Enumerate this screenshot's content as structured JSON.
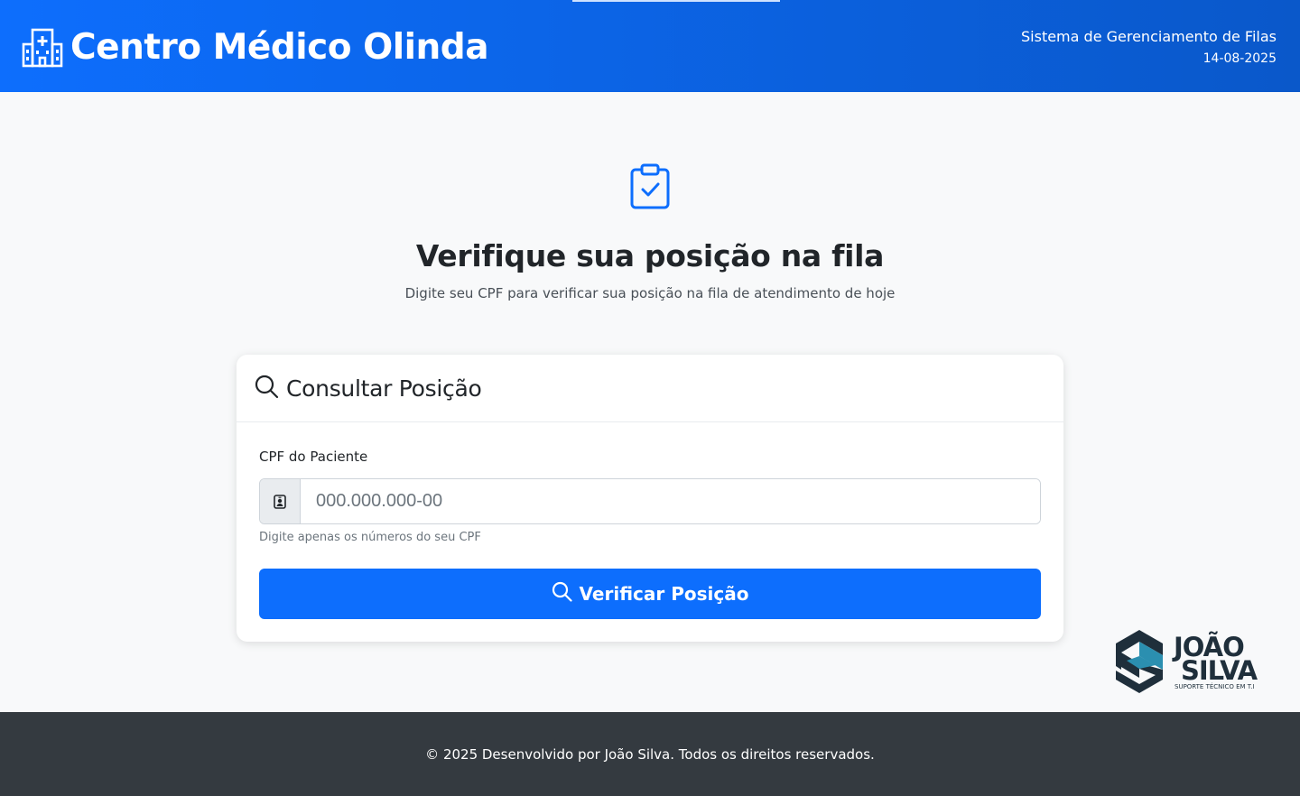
{
  "header": {
    "title": "Centro Médico Olinda",
    "system_name": "Sistema de Gerenciamento de Filas",
    "date": "14-08-2025",
    "icon": "hospital-icon"
  },
  "hero": {
    "icon": "clipboard-check-icon",
    "title": "Verifique sua posição na fila",
    "subtitle": "Digite seu CPF para verificar sua posição na fila de atendimento de hoje"
  },
  "card": {
    "title": "Consultar Posição",
    "title_icon": "search-icon",
    "field_label": "CPF do Paciente",
    "field_icon": "person-badge-icon",
    "field_placeholder": "000.000.000-00",
    "field_value": "",
    "help_text": "Digite apenas os números do seu CPF",
    "button_label": "Verificar Posição",
    "button_icon": "search-icon"
  },
  "logo": {
    "line1": "JOÃO",
    "line2": "SILVA",
    "tagline": "SUPORTE TÉCNICO EM T.I"
  },
  "footer": {
    "text": "© 2025 Desenvolvido por João Silva. Todos os direitos reservados."
  },
  "colors": {
    "primary": "#0d6efd",
    "footer_bg": "#343a40",
    "page_bg": "#f8f9fa"
  }
}
